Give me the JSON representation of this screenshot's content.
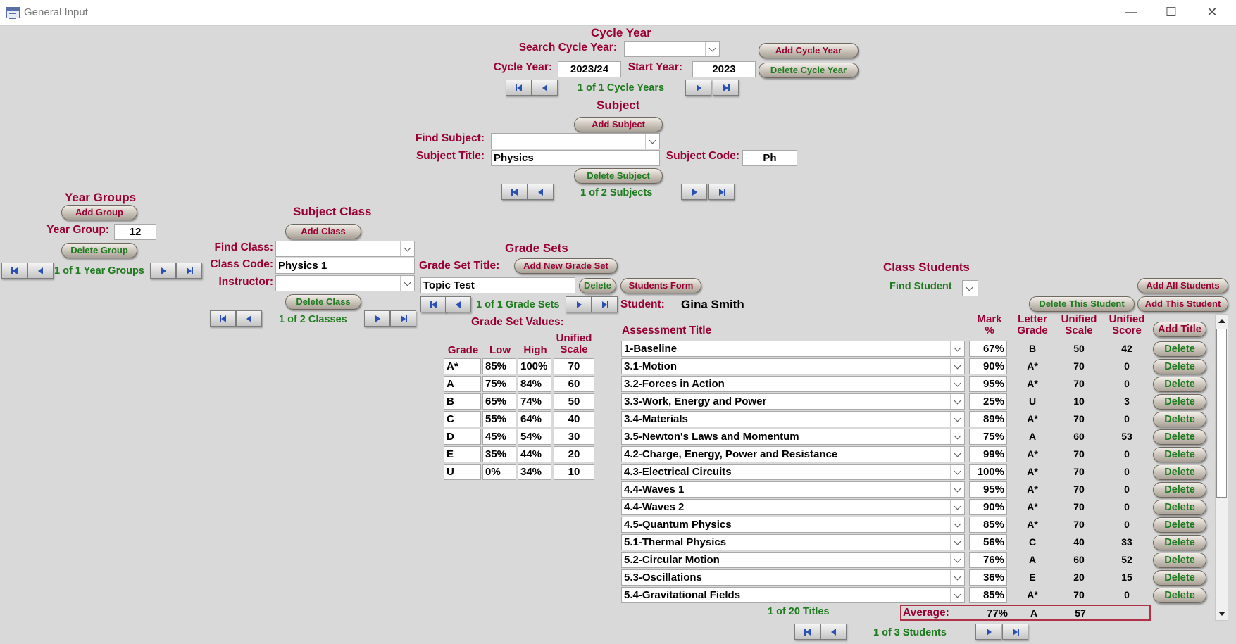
{
  "window": {
    "title": "General Input"
  },
  "cycle": {
    "heading": "Cycle Year",
    "search_label": "Search Cycle Year:",
    "search_value": "",
    "year_label": "Cycle Year:",
    "year_value": "2023/24",
    "start_label": "Start Year:",
    "start_value": "2023",
    "add_btn": "Add Cycle Year",
    "delete_btn": "Delete Cycle Year",
    "nav_text": "1 of 1 Cycle Years"
  },
  "subject": {
    "heading": "Subject",
    "add_btn": "Add Subject",
    "find_label": "Find Subject:",
    "find_value": "",
    "title_label": "Subject Title:",
    "title_value": "Physics",
    "code_label": "Subject Code:",
    "code_value": "Ph",
    "delete_btn": "Delete Subject",
    "nav_text": "1 of 2 Subjects"
  },
  "year_groups": {
    "heading": "Year Groups",
    "add_btn": "Add Group",
    "label": "Year Group:",
    "value": "12",
    "delete_btn": "Delete Group",
    "nav_text": "1 of 1 Year Groups"
  },
  "subject_class": {
    "heading": "Subject Class",
    "add_btn": "Add Class",
    "find_label": "Find Class:",
    "find_value": "",
    "code_label": "Class Code:",
    "code_value": "Physics 1",
    "instructor_label": "Instructor:",
    "instructor_value": "",
    "delete_btn": "Delete Class",
    "nav_text": "1 of 2 Classes"
  },
  "grade_sets": {
    "heading": "Grade Sets",
    "title_label": "Grade Set Title:",
    "add_btn": "Add New Grade Set",
    "title_value": "Topic Test",
    "delete_btn": "Delete",
    "nav_text": "1 of 1 Grade Sets",
    "values_label": "Grade Set Values:",
    "columns": {
      "grade": "Grade",
      "low": "Low",
      "high": "High",
      "scale1": "Unified",
      "scale2": "Scale"
    },
    "rows": [
      {
        "grade": "A*",
        "low": "85%",
        "high": "100%",
        "scale": "70"
      },
      {
        "grade": "A",
        "low": "75%",
        "high": "84%",
        "scale": "60"
      },
      {
        "grade": "B",
        "low": "65%",
        "high": "74%",
        "scale": "50"
      },
      {
        "grade": "C",
        "low": "55%",
        "high": "64%",
        "scale": "40"
      },
      {
        "grade": "D",
        "low": "45%",
        "high": "54%",
        "scale": "30"
      },
      {
        "grade": "E",
        "low": "35%",
        "high": "44%",
        "scale": "20"
      },
      {
        "grade": "U",
        "low": "0%",
        "high": "34%",
        "scale": "10"
      }
    ]
  },
  "students": {
    "heading": "Class Students",
    "students_form_btn": "Students Form",
    "find_label": "Find Student",
    "add_all_btn": "Add All Students",
    "delete_this_btn": "Delete This Student",
    "add_this_btn": "Add This Student",
    "student_label": "Student:",
    "student_name": "Gina Smith",
    "add_title_btn": "Add Title",
    "delete_btn": "Delete",
    "columns": {
      "title": "Assessment Title",
      "mark1": "Mark",
      "mark2": "%",
      "letter1": "Letter",
      "letter2": "Grade",
      "uscale1": "Unified",
      "uscale2": "Scale",
      "uscore1": "Unified",
      "uscore2": "Score"
    },
    "rows": [
      {
        "title": "1-Baseline",
        "mark": "67%",
        "grade": "B",
        "scale": "50",
        "score": "42"
      },
      {
        "title": "3.1-Motion",
        "mark": "90%",
        "grade": "A*",
        "scale": "70",
        "score": "0"
      },
      {
        "title": "3.2-Forces in Action",
        "mark": "95%",
        "grade": "A*",
        "scale": "70",
        "score": "0"
      },
      {
        "title": "3.3-Work, Energy and Power",
        "mark": "25%",
        "grade": "U",
        "scale": "10",
        "score": "3"
      },
      {
        "title": "3.4-Materials",
        "mark": "89%",
        "grade": "A*",
        "scale": "70",
        "score": "0"
      },
      {
        "title": "3.5-Newton's Laws and Momentum",
        "mark": "75%",
        "grade": "A",
        "scale": "60",
        "score": "53"
      },
      {
        "title": "4.2-Charge, Energy, Power and Resistance",
        "mark": "99%",
        "grade": "A*",
        "scale": "70",
        "score": "0"
      },
      {
        "title": "4.3-Electrical Circuits",
        "mark": "100%",
        "grade": "A*",
        "scale": "70",
        "score": "0"
      },
      {
        "title": "4.4-Waves 1",
        "mark": "95%",
        "grade": "A*",
        "scale": "70",
        "score": "0"
      },
      {
        "title": "4.4-Waves 2",
        "mark": "90%",
        "grade": "A*",
        "scale": "70",
        "score": "0"
      },
      {
        "title": "4.5-Quantum Physics",
        "mark": "85%",
        "grade": "A*",
        "scale": "70",
        "score": "0"
      },
      {
        "title": "5.1-Thermal Physics",
        "mark": "56%",
        "grade": "C",
        "scale": "40",
        "score": "33"
      },
      {
        "title": "5.2-Circular Motion",
        "mark": "76%",
        "grade": "A",
        "scale": "60",
        "score": "52"
      },
      {
        "title": "5.3-Oscillations",
        "mark": "36%",
        "grade": "E",
        "scale": "20",
        "score": "15"
      },
      {
        "title": "5.4-Gravitational Fields",
        "mark": "85%",
        "grade": "A*",
        "scale": "70",
        "score": "0"
      }
    ],
    "titles_nav_text": "1 of 20 Titles",
    "average_label": "Average:",
    "average_mark": "77%",
    "average_grade": "A",
    "average_scale": "57",
    "nav_text": "1 of 3 Students"
  },
  "colors": {
    "label": "#990033",
    "nav_text": "#1e7b1e",
    "background": "#d9d9d9"
  }
}
